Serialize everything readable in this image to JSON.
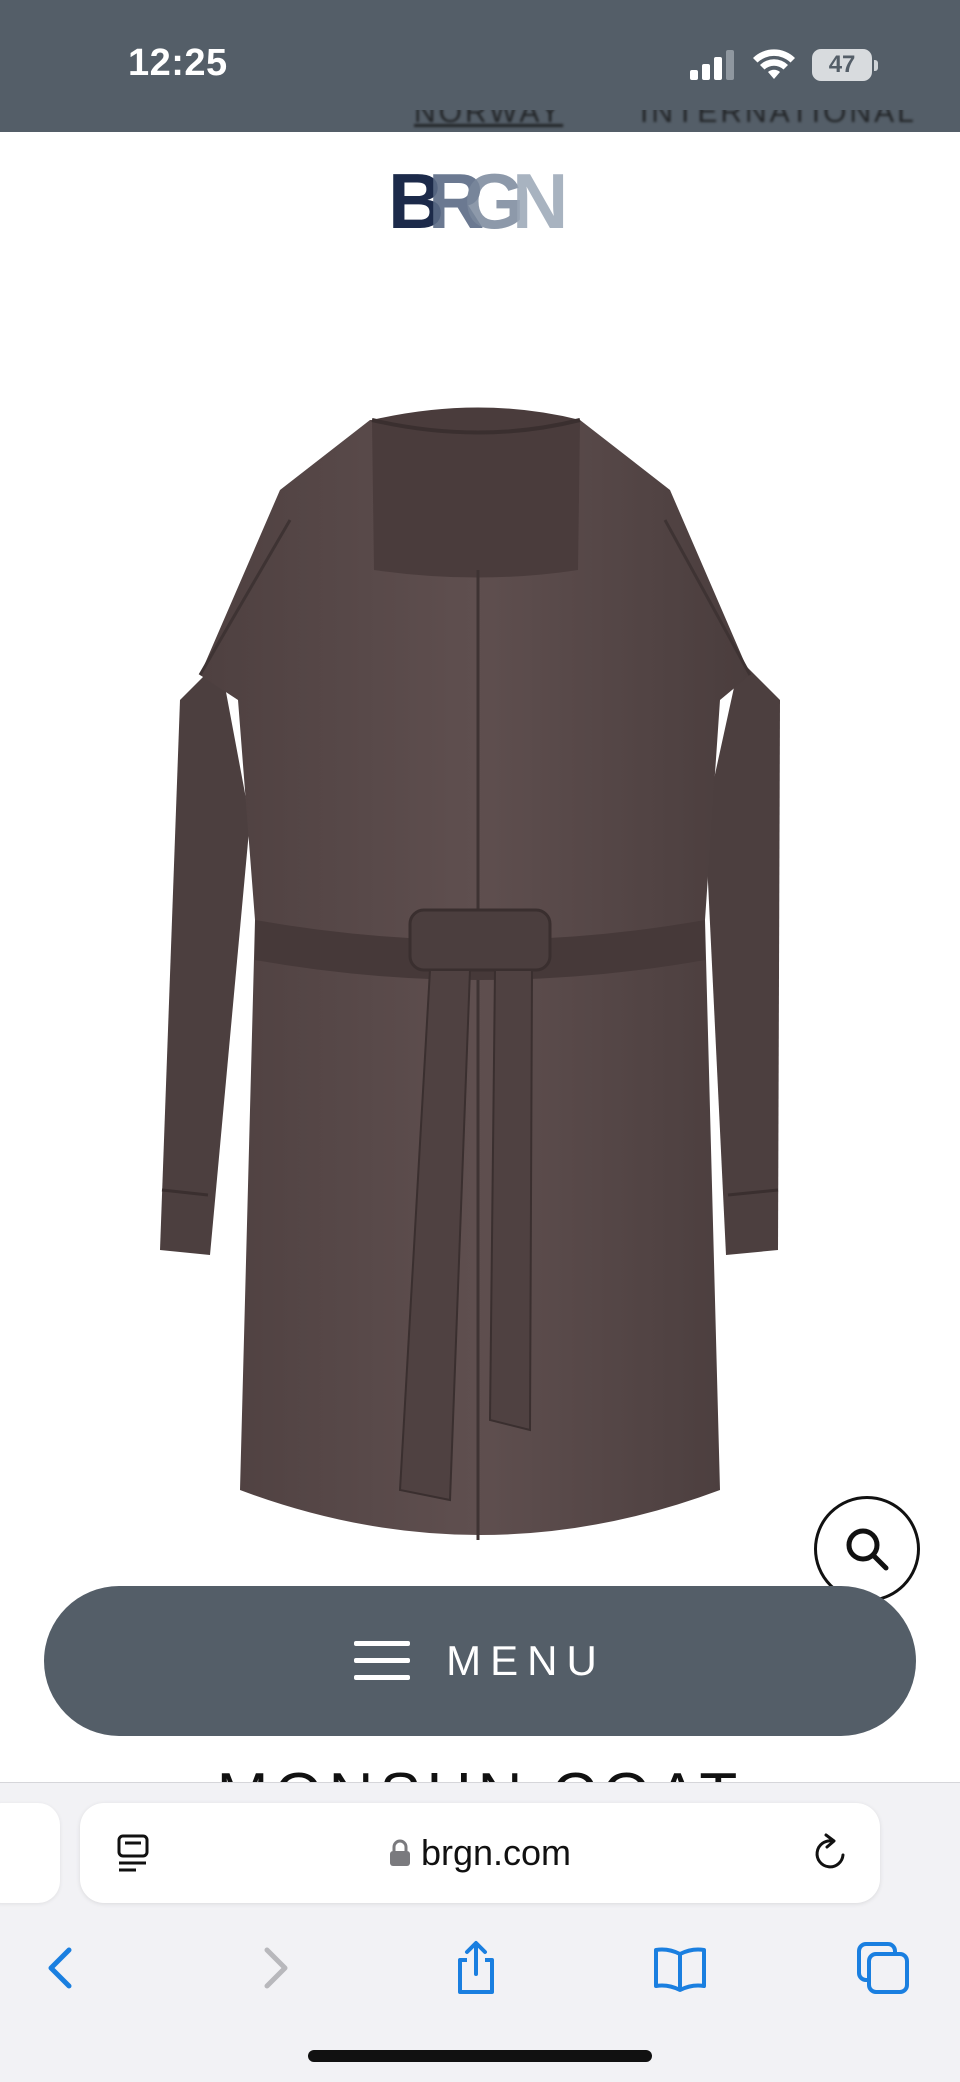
{
  "status_bar": {
    "time": "12:25",
    "battery_level": "47",
    "icons": [
      "signal-icon",
      "wifi-icon",
      "battery-icon"
    ],
    "background_color": "#545e68"
  },
  "header": {
    "links": [
      "NORWAY",
      "INTERNATIONAL"
    ],
    "logo_text": "BRGN",
    "logo_colors": [
      "#1c2a4a",
      "#5b6b86",
      "#9aa6b6"
    ]
  },
  "product": {
    "image_alt": "Brown belted coat",
    "coat_color": "#5a4a4a",
    "title": "MONSUN COAT"
  },
  "zoom_button": {
    "icon": "search-icon"
  },
  "menu": {
    "label": "MENU",
    "icon": "hamburger-icon",
    "background_color": "#545e68"
  },
  "browser": {
    "url": "brgn.com",
    "icons": [
      "reader-icon",
      "lock-icon",
      "reload-icon"
    ],
    "toolbar": [
      "back-icon",
      "forward-icon",
      "share-icon",
      "bookmarks-icon",
      "tabs-icon"
    ],
    "accent_color": "#1a7fe0"
  }
}
